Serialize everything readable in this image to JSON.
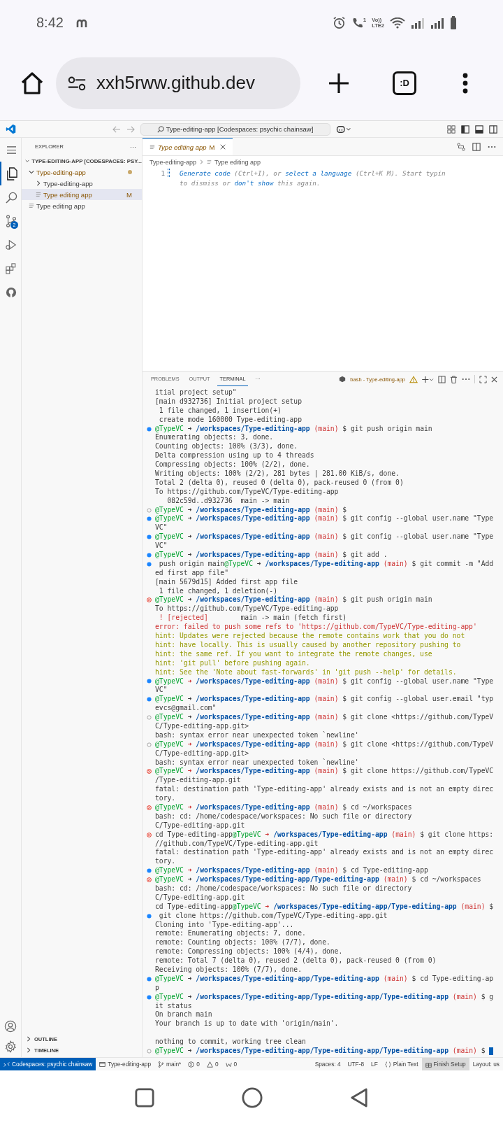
{
  "phone_status": {
    "time": "8:42",
    "call_badge": "1",
    "volte": [
      "Vo))",
      "LTE2"
    ]
  },
  "browser": {
    "url": "xxh5rww.github.dev",
    "tab_badge": ":D"
  },
  "title_bar": {
    "command_center": "Type-editing-app [Codespaces: psychic chainsaw]"
  },
  "activity_bar": [
    {
      "kind": "menu",
      "selected": false
    },
    {
      "kind": "files",
      "selected": true
    },
    {
      "kind": "search",
      "selected": false
    },
    {
      "kind": "scm",
      "selected": false,
      "badge": "2"
    },
    {
      "kind": "run",
      "selected": false
    },
    {
      "kind": "extensions",
      "selected": false
    },
    {
      "kind": "github",
      "selected": false
    }
  ],
  "sidebar": {
    "title": "EXPLORER",
    "more": "···",
    "section": {
      "label": "TYPE-EDITING-APP [CODESPACES: PSY...",
      "expanded": true,
      "children": [
        {
          "label": "Type-editing-app",
          "kind": "folder",
          "expanded": true,
          "selected": false,
          "modified": true,
          "children": [
            {
              "label": "Type-editing-app",
              "kind": "folder",
              "expanded": false,
              "selected": false,
              "modified": false
            },
            {
              "label": "Type editing app",
              "kind": "file",
              "selected": true,
              "modified": true,
              "badge": "M"
            }
          ]
        },
        {
          "label": "Type editing app",
          "kind": "file",
          "selected": false,
          "modified": false
        }
      ]
    },
    "bottom_sections": [
      {
        "label": "OUTLINE",
        "expanded": false
      },
      {
        "label": "TIMELINE",
        "expanded": false
      }
    ]
  },
  "editor": {
    "tabs": [
      {
        "label": "Type editing app",
        "badge": "M",
        "selected": true,
        "modified": true
      }
    ],
    "breadcrumb": [
      "Type-editing-app",
      "Type editing app"
    ],
    "lines": [
      {
        "number": "1",
        "parts": [
          {
            "text": "Generate code",
            "link": true
          },
          {
            "text": " (Ctrl+I), or ",
            "link": false
          },
          {
            "text": "select a language",
            "link": true
          },
          {
            "text": " (Ctrl+K M). Start typin",
            "link": false
          }
        ]
      },
      {
        "parts": [
          {
            "text": "to dismiss or ",
            "link": false
          },
          {
            "text": "don't show",
            "link": true
          },
          {
            "text": " this again.",
            "link": false
          }
        ]
      }
    ]
  },
  "panel": {
    "tabs": [
      {
        "label": "PROBLEMS",
        "selected": false
      },
      {
        "label": "OUTPUT",
        "selected": false
      },
      {
        "label": "TERMINAL",
        "selected": true
      }
    ],
    "more": "···",
    "terminal_name": "bash - Type-editing-app"
  },
  "terminal": {
    "lines": [
      {
        "parts": [
          {
            "kind": "text",
            "text": "itial project setup\""
          }
        ]
      },
      {
        "parts": [
          {
            "kind": "text",
            "text": "[main d932736] Initial project setup"
          }
        ]
      },
      {
        "parts": [
          {
            "kind": "text",
            "text": " 1 file changed, 1 insertion(+)"
          }
        ]
      },
      {
        "parts": [
          {
            "kind": "text",
            "text": " create mode 160000 Type-editing-app"
          }
        ]
      },
      {
        "kind": "ok",
        "parts": [
          {
            "kind": "prompt",
            "user": "@TypeVC",
            "arrow": "➜",
            "failed": false,
            "path": "/workspaces/Type-editing-app",
            "branch": "(main)"
          },
          {
            "kind": "text",
            "text": " $ git push origin main"
          }
        ]
      },
      {
        "parts": [
          {
            "kind": "text",
            "text": "Enumerating objects: 3, done."
          }
        ]
      },
      {
        "parts": [
          {
            "kind": "text",
            "text": "Counting objects: 100% (3/3), done."
          }
        ]
      },
      {
        "parts": [
          {
            "kind": "text",
            "text": "Delta compression using up to 4 threads"
          }
        ]
      },
      {
        "parts": [
          {
            "kind": "text",
            "text": "Compressing objects: 100% (2/2), done."
          }
        ]
      },
      {
        "parts": [
          {
            "kind": "text",
            "text": "Writing objects: 100% (2/2), 281 bytes | 281.00 KiB/s, done."
          }
        ]
      },
      {
        "parts": [
          {
            "kind": "text",
            "text": "Total 2 (delta 0), reused 0 (delta 0), pack-reused 0 (from 0)"
          }
        ]
      },
      {
        "parts": [
          {
            "kind": "text",
            "text": "To https://github.com/TypeVC/Type-editing-app"
          }
        ]
      },
      {
        "parts": [
          {
            "kind": "text",
            "text": "   082c59d..d932736  main -> main"
          }
        ]
      },
      {
        "kind": "idle",
        "parts": [
          {
            "kind": "prompt",
            "user": "@TypeVC",
            "arrow": "➜",
            "failed": false,
            "path": "/workspaces/Type-editing-app",
            "branch": "(main)"
          },
          {
            "kind": "text",
            "text": " $"
          }
        ]
      },
      {
        "kind": "ok",
        "parts": [
          {
            "kind": "prompt",
            "user": "@TypeVC",
            "arrow": "➜",
            "failed": false,
            "path": "/workspaces/Type-editing-app",
            "branch": "(main)"
          },
          {
            "kind": "text",
            "text": " $ git config --global user.name \"Type"
          }
        ]
      },
      {
        "parts": [
          {
            "kind": "text",
            "text": "VC\""
          }
        ]
      },
      {
        "kind": "ok",
        "parts": [
          {
            "kind": "prompt",
            "user": "@TypeVC",
            "arrow": "➜",
            "failed": false,
            "path": "/workspaces/Type-editing-app",
            "branch": "(main)"
          },
          {
            "kind": "text",
            "text": " $ git config --global user.name \"Type"
          }
        ]
      },
      {
        "parts": [
          {
            "kind": "text",
            "text": "VC\""
          }
        ]
      },
      {
        "kind": "ok",
        "parts": [
          {
            "kind": "prompt",
            "user": "@TypeVC",
            "arrow": "➜",
            "failed": false,
            "path": "/workspaces/Type-editing-app",
            "branch": "(main)"
          },
          {
            "kind": "text",
            "text": " $ git add ."
          }
        ]
      },
      {
        "kind": "ok",
        "parts": [
          {
            "kind": "text",
            "text": " push origin main"
          },
          {
            "kind": "prompt",
            "user": "@TypeVC",
            "arrow": "➜",
            "failed": false,
            "path": "/workspaces/Type-editing-app",
            "branch": "(main)"
          },
          {
            "kind": "text",
            "text": " $ git commit -m \"Add"
          }
        ]
      },
      {
        "parts": [
          {
            "kind": "text",
            "text": "ed first app file\""
          }
        ]
      },
      {
        "parts": [
          {
            "kind": "text",
            "text": "[main 5679d15] Added first app file"
          }
        ]
      },
      {
        "parts": [
          {
            "kind": "text",
            "text": " 1 file changed, 1 deletion(-)"
          }
        ]
      },
      {
        "kind": "fail",
        "parts": [
          {
            "kind": "prompt",
            "user": "@TypeVC",
            "arrow": "➜",
            "failed": false,
            "path": "/workspaces/Type-editing-app",
            "branch": "(main)"
          },
          {
            "kind": "text",
            "text": " $ git push origin main"
          }
        ]
      },
      {
        "parts": [
          {
            "kind": "text",
            "text": "To https://github.com/TypeVC/Type-editing-app"
          }
        ]
      },
      {
        "parts": [
          {
            "kind": "error",
            "text": " ! [rejected]"
          },
          {
            "kind": "text",
            "text": "        main -> main (fetch first)"
          }
        ]
      },
      {
        "parts": [
          {
            "kind": "error",
            "text": "error: failed to push some refs to 'https://github.com/TypeVC/Type-editing-app'"
          }
        ]
      },
      {
        "parts": [
          {
            "kind": "hint",
            "text": "hint: Updates were rejected because the remote contains work that you do not"
          }
        ]
      },
      {
        "parts": [
          {
            "kind": "hint",
            "text": "hint: have locally. This is usually caused by another repository pushing to"
          }
        ]
      },
      {
        "parts": [
          {
            "kind": "hint",
            "text": "hint: the same ref. If you want to integrate the remote changes, use"
          }
        ]
      },
      {
        "parts": [
          {
            "kind": "hint",
            "text": "hint: 'git pull' before pushing again."
          }
        ]
      },
      {
        "parts": [
          {
            "kind": "hint",
            "text": "hint: See the 'Note about fast-forwards' in 'git push --help' for details."
          }
        ]
      },
      {
        "kind": "ok",
        "parts": [
          {
            "kind": "prompt",
            "user": "@TypeVC",
            "arrow": "➜",
            "failed": true,
            "path": "/workspaces/Type-editing-app",
            "branch": "(main)"
          },
          {
            "kind": "text",
            "text": " $ git config --global user.name \"Type"
          }
        ]
      },
      {
        "parts": [
          {
            "kind": "text",
            "text": "VC\""
          }
        ]
      },
      {
        "kind": "ok",
        "parts": [
          {
            "kind": "prompt",
            "user": "@TypeVC",
            "arrow": "➜",
            "failed": false,
            "path": "/workspaces/Type-editing-app",
            "branch": "(main)"
          },
          {
            "kind": "text",
            "text": " $ git config --global user.email \"typ"
          }
        ]
      },
      {
        "parts": [
          {
            "kind": "text",
            "text": "evcs@gmail.com\""
          }
        ]
      },
      {
        "kind": "idle",
        "parts": [
          {
            "kind": "prompt",
            "user": "@TypeVC",
            "arrow": "➜",
            "failed": false,
            "path": "/workspaces/Type-editing-app",
            "branch": "(main)"
          },
          {
            "kind": "text",
            "text": " $ git clone <https://github.com/TypeV"
          }
        ]
      },
      {
        "parts": [
          {
            "kind": "text",
            "text": "C/Type-editing-app.git>"
          }
        ]
      },
      {
        "parts": [
          {
            "kind": "text",
            "text": "bash: syntax error near unexpected token `newline'"
          }
        ]
      },
      {
        "kind": "idle",
        "parts": [
          {
            "kind": "prompt",
            "user": "@TypeVC",
            "arrow": "➜",
            "failed": true,
            "path": "/workspaces/Type-editing-app",
            "branch": "(main)"
          },
          {
            "kind": "text",
            "text": " $ git clone <https://github.com/TypeV"
          }
        ]
      },
      {
        "parts": [
          {
            "kind": "text",
            "text": "C/Type-editing-app.git>"
          }
        ]
      },
      {
        "parts": [
          {
            "kind": "text",
            "text": "bash: syntax error near unexpected token `newline'"
          }
        ]
      },
      {
        "kind": "fail",
        "parts": [
          {
            "kind": "prompt",
            "user": "@TypeVC",
            "arrow": "➜",
            "failed": true,
            "path": "/workspaces/Type-editing-app",
            "branch": "(main)"
          },
          {
            "kind": "text",
            "text": " $ git clone https://github.com/TypeVC"
          }
        ]
      },
      {
        "parts": [
          {
            "kind": "text",
            "text": "/Type-editing-app.git"
          }
        ]
      },
      {
        "parts": [
          {
            "kind": "text",
            "text": "fatal: destination path 'Type-editing-app' already exists and is not an empty direc"
          }
        ]
      },
      {
        "parts": [
          {
            "kind": "text",
            "text": "tory."
          }
        ]
      },
      {
        "kind": "fail",
        "parts": [
          {
            "kind": "prompt",
            "user": "@TypeVC",
            "arrow": "➜",
            "failed": true,
            "path": "/workspaces/Type-editing-app",
            "branch": "(main)"
          },
          {
            "kind": "text",
            "text": " $ cd ~/workspaces"
          }
        ]
      },
      {
        "parts": [
          {
            "kind": "text",
            "text": "bash: cd: /home/codespace/workspaces: No such file or directory"
          }
        ]
      },
      {
        "parts": [
          {
            "kind": "text",
            "text": "C/Type-editing-app.git"
          }
        ]
      },
      {
        "kind": "fail",
        "parts": [
          {
            "kind": "text",
            "text": "cd Type-editing-app"
          },
          {
            "kind": "prompt",
            "user": "@TypeVC",
            "arrow": "➜",
            "failed": true,
            "path": "/workspaces/Type-editing-app",
            "branch": "(main)"
          },
          {
            "kind": "text",
            "text": " $ git clone https:"
          }
        ]
      },
      {
        "parts": [
          {
            "kind": "text",
            "text": "//github.com/TypeVC/Type-editing-app.git"
          }
        ]
      },
      {
        "parts": [
          {
            "kind": "text",
            "text": "fatal: destination path 'Type-editing-app' already exists and is not an empty direc"
          }
        ]
      },
      {
        "parts": [
          {
            "kind": "text",
            "text": "tory."
          }
        ]
      },
      {
        "kind": "ok",
        "parts": [
          {
            "kind": "prompt",
            "user": "@TypeVC",
            "arrow": "➜",
            "failed": true,
            "path": "/workspaces/Type-editing-app",
            "branch": "(main)"
          },
          {
            "kind": "text",
            "text": " $ cd Type-editing-app"
          }
        ]
      },
      {
        "kind": "fail",
        "parts": [
          {
            "kind": "prompt",
            "user": "@TypeVC",
            "arrow": "➜",
            "failed": false,
            "path": "/workspaces/Type-editing-app/Type-editing-app",
            "branch": "(main)"
          },
          {
            "kind": "text",
            "text": " $ cd ~/workspaces"
          }
        ]
      },
      {
        "parts": [
          {
            "kind": "text",
            "text": "bash: cd: /home/codespace/workspaces: No such file or directory"
          }
        ]
      },
      {
        "parts": [
          {
            "kind": "text",
            "text": "C/Type-editing-app.git"
          }
        ]
      },
      {
        "parts": [
          {
            "kind": "text",
            "text": "cd Type-editing-app"
          },
          {
            "kind": "prompt",
            "user": "@TypeVC",
            "arrow": "➜",
            "failed": true,
            "path": "/workspaces/Type-editing-app/Type-editing-app",
            "branch": "(main)"
          },
          {
            "kind": "text",
            "text": " $"
          }
        ]
      },
      {
        "kind": "ok",
        "parts": [
          {
            "kind": "text",
            "text": " git clone https://github.com/TypeVC/Type-editing-app.git"
          }
        ]
      },
      {
        "parts": [
          {
            "kind": "text",
            "text": "Cloning into 'Type-editing-app'..."
          }
        ]
      },
      {
        "parts": [
          {
            "kind": "text",
            "text": "remote: Enumerating objects: 7, done."
          }
        ]
      },
      {
        "parts": [
          {
            "kind": "text",
            "text": "remote: Counting objects: 100% (7/7), done."
          }
        ]
      },
      {
        "parts": [
          {
            "kind": "text",
            "text": "remote: Compressing objects: 100% (4/4), done."
          }
        ]
      },
      {
        "parts": [
          {
            "kind": "text",
            "text": "remote: Total 7 (delta 0), reused 2 (delta 0), pack-reused 0 (from 0)"
          }
        ]
      },
      {
        "parts": [
          {
            "kind": "text",
            "text": "Receiving objects: 100% (7/7), done."
          }
        ]
      },
      {
        "kind": "ok",
        "parts": [
          {
            "kind": "prompt",
            "user": "@TypeVC",
            "arrow": "➜",
            "failed": false,
            "path": "/workspaces/Type-editing-app/Type-editing-app",
            "branch": "(main)"
          },
          {
            "kind": "text",
            "text": " $ cd Type-editing-ap"
          }
        ]
      },
      {
        "parts": [
          {
            "kind": "text",
            "text": "p"
          }
        ]
      },
      {
        "kind": "ok",
        "parts": [
          {
            "kind": "prompt",
            "user": "@TypeVC",
            "arrow": "➜",
            "failed": false,
            "path": "/workspaces/Type-editing-app/Type-editing-app/Type-editing-app",
            "branch": "(main)"
          },
          {
            "kind": "text",
            "text": " $ g"
          }
        ]
      },
      {
        "parts": [
          {
            "kind": "text",
            "text": "it status"
          }
        ]
      },
      {
        "parts": [
          {
            "kind": "text",
            "text": "On branch main"
          }
        ]
      },
      {
        "parts": [
          {
            "kind": "text",
            "text": "Your branch is up to date with 'origin/main'."
          }
        ]
      },
      {
        "kind": "blank"
      },
      {
        "parts": [
          {
            "kind": "text",
            "text": "nothing to commit, working tree clean"
          }
        ]
      },
      {
        "kind": "idle",
        "cursor": true,
        "parts": [
          {
            "kind": "prompt",
            "user": "@TypeVC",
            "arrow": "➜",
            "failed": false,
            "path": "/workspaces/Type-editing-app/Type-editing-app/Type-editing-app",
            "branch": "(main)"
          },
          {
            "kind": "text",
            "text": " $ "
          }
        ]
      }
    ]
  },
  "status_bar": {
    "left": [
      {
        "kind": "remote",
        "text": "Codespaces: psychic chainsaw",
        "highlighted": true
      },
      {
        "kind": "window",
        "text": "Type-editing-app",
        "highlighted": false
      },
      {
        "kind": "branch",
        "text": "main*",
        "highlighted": false
      },
      {
        "kind": "error",
        "text": "0",
        "highlighted": false
      },
      {
        "kind": "warning",
        "text": "0",
        "highlighted": false
      },
      {
        "kind": "ports",
        "text": "0",
        "highlighted": false
      }
    ],
    "right": [
      {
        "kind": "plain",
        "text": "Spaces: 4",
        "highlighted": false
      },
      {
        "kind": "plain",
        "text": "UTF-8",
        "highlighted": false
      },
      {
        "kind": "plain",
        "text": "LF",
        "highlighted": false
      },
      {
        "kind": "braces",
        "text": "Plain Text",
        "highlighted": false
      },
      {
        "kind": "setup",
        "text": "Finish Setup",
        "highlighted": true
      },
      {
        "kind": "plain",
        "text": "Layout: us",
        "highlighted": false
      }
    ]
  }
}
